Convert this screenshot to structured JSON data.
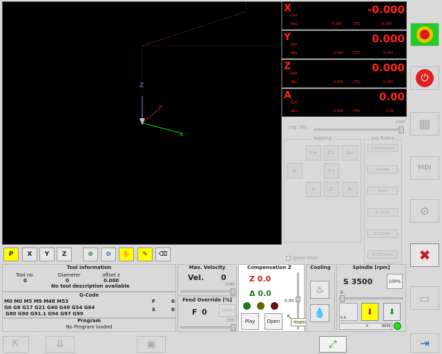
{
  "dro": [
    {
      "axis": "X",
      "value": "-0.000",
      "g54": "G54",
      "abs": "Abs",
      "abs_val": "-0.000",
      "dtg": "DTG",
      "dtg_val": "-0.000"
    },
    {
      "axis": "Y",
      "value": "0.000",
      "g54": "G54",
      "abs": "Abs",
      "abs_val": "0.000",
      "dtg": "DTG",
      "dtg_val": "0.000"
    },
    {
      "axis": "Z",
      "value": "0.000",
      "g54": "G54",
      "abs": "Abs",
      "abs_val": "0.000",
      "dtg": "DTG",
      "dtg_val": "0.000"
    },
    {
      "axis": "A",
      "value": "0.00",
      "g54": "G54",
      "abs": "Abs",
      "abs_val": "0.000",
      "dtg": "DTG",
      "dtg_val": "0.00"
    }
  ],
  "jog": {
    "vel_label": "Jog. Vel.",
    "vel_max": "1080",
    "jogging_title": "Jogging",
    "rates_title": "Jog Rates",
    "buttons": {
      "yplus": "Y+",
      "zplus": "Z+",
      "aplus": "A+",
      "xminus": "X-",
      "xplus": "X+",
      "yminus": "Y-",
      "zminus": "Z-",
      "aminus": "A-"
    },
    "rates": [
      "Continuous",
      "10mm",
      "1mm",
      "0.1mm",
      "0.01mm",
      "0.001mm"
    ],
    "ignore_limits": "Ignore limits"
  },
  "toolbar": {
    "x": "X",
    "y": "Y",
    "z": "Z"
  },
  "tool_info": {
    "title": "Tool information",
    "tool_no_label": "Tool no.",
    "tool_no": "0",
    "diameter_label": "Diameter",
    "diameter": "0",
    "offset_label": "offset z",
    "offset": "0.000",
    "description": "No tool description available"
  },
  "gcode": {
    "title": "G-Code",
    "line1": "M0 M0 M5 M9 M48 M53",
    "line2": "G0 G8 G17 G21 G40 G49 G54 G64",
    "line3": "G80 G90 G91.1 G94 G97 G99",
    "f_label": "F",
    "f_val": "0",
    "s_label": "S",
    "s_val": "0"
  },
  "program": {
    "title": "Program",
    "status": "No Program loaded"
  },
  "velocity": {
    "title": "Max. Velocity",
    "label": "Vel.",
    "value": "0",
    "max": "1080"
  },
  "feed": {
    "title": "Feed Override [%]",
    "label": "F",
    "value": "0",
    "pct": "100%",
    "max": "100"
  },
  "compensation": {
    "title": "Compensation Z",
    "z": "Z 0.0",
    "delta": "Δ 0.0",
    "value": "0.00",
    "play": "Play",
    "open": "Open",
    "tooltip": "manual adj"
  },
  "cooling": {
    "title": "Cooling"
  },
  "spindle": {
    "title": "Spindle [rpm]",
    "speed": "S 3500",
    "pct": "100%",
    "min": "0",
    "val": "0.0",
    "axis0": "0",
    "axis6000": "6000"
  },
  "colors": {
    "dro_red": "#ff2020",
    "estop_green": "#22cc22",
    "power_red": "#e02020"
  }
}
